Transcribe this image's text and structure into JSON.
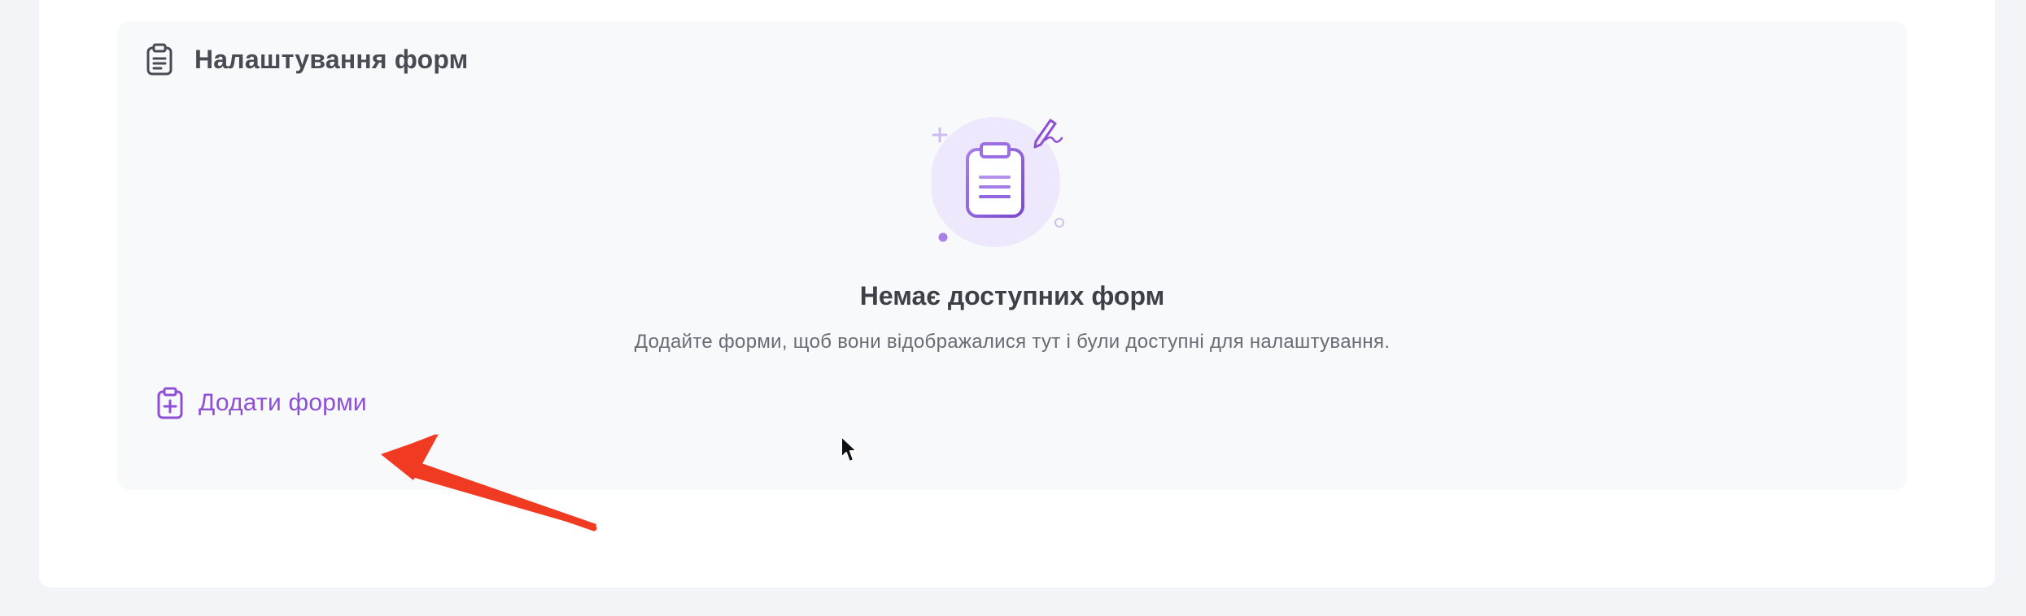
{
  "section": {
    "title": "Налаштування форм",
    "header_icon": "clipboard-list-icon"
  },
  "empty_state": {
    "illustration": "clipboard-with-pen-illustration",
    "title": "Немає доступних форм",
    "description": "Додайте форми, щоб вони відображалися тут і були доступні для налаштування."
  },
  "add_button": {
    "label": "Додати форми",
    "icon": "clipboard-plus-icon"
  },
  "annotation": {
    "type": "arrow",
    "color": "#f03a22"
  },
  "colors": {
    "accent": "#8e4fd6",
    "panel_bg": "#f8f9fb",
    "page_bg": "#f3f4f8",
    "card_bg": "#ffffff",
    "title_text": "#3f3f48",
    "muted_text": "#6b6b76"
  }
}
